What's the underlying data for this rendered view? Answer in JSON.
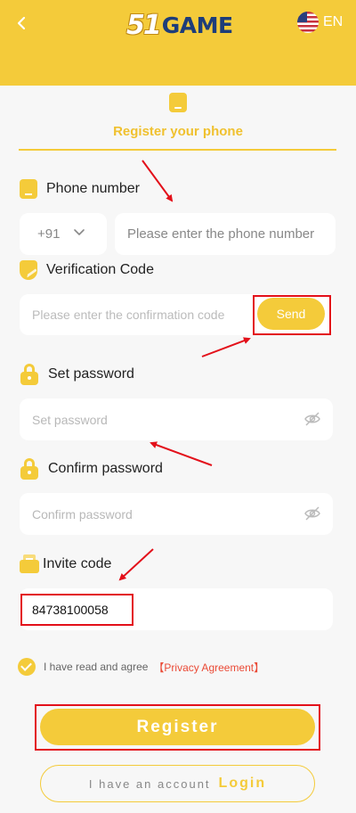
{
  "header": {
    "logo_prefix": "51",
    "logo_suffix": "GAME",
    "language": "EN",
    "accent_color": "#f4cb3a"
  },
  "tab": {
    "label": "Register your phone"
  },
  "phone": {
    "label": "Phone number",
    "country_code": "+91",
    "placeholder": "Please enter the phone number"
  },
  "verification": {
    "label": "Verification Code",
    "placeholder": "Please enter the confirmation code",
    "send_label": "Send"
  },
  "password": {
    "label": "Set password",
    "placeholder": "Set password"
  },
  "confirm_password": {
    "label": "Confirm password",
    "placeholder": "Confirm password"
  },
  "invite": {
    "label": "Invite code",
    "value": "84738100058"
  },
  "agreement": {
    "text": "I have read and agree",
    "link": "【Privacy Agreement】",
    "checked": true
  },
  "actions": {
    "register_label": "Register",
    "have_account": "I have an account",
    "login_label": "Login"
  },
  "annotations": {
    "highlight_color": "#e3101a"
  }
}
